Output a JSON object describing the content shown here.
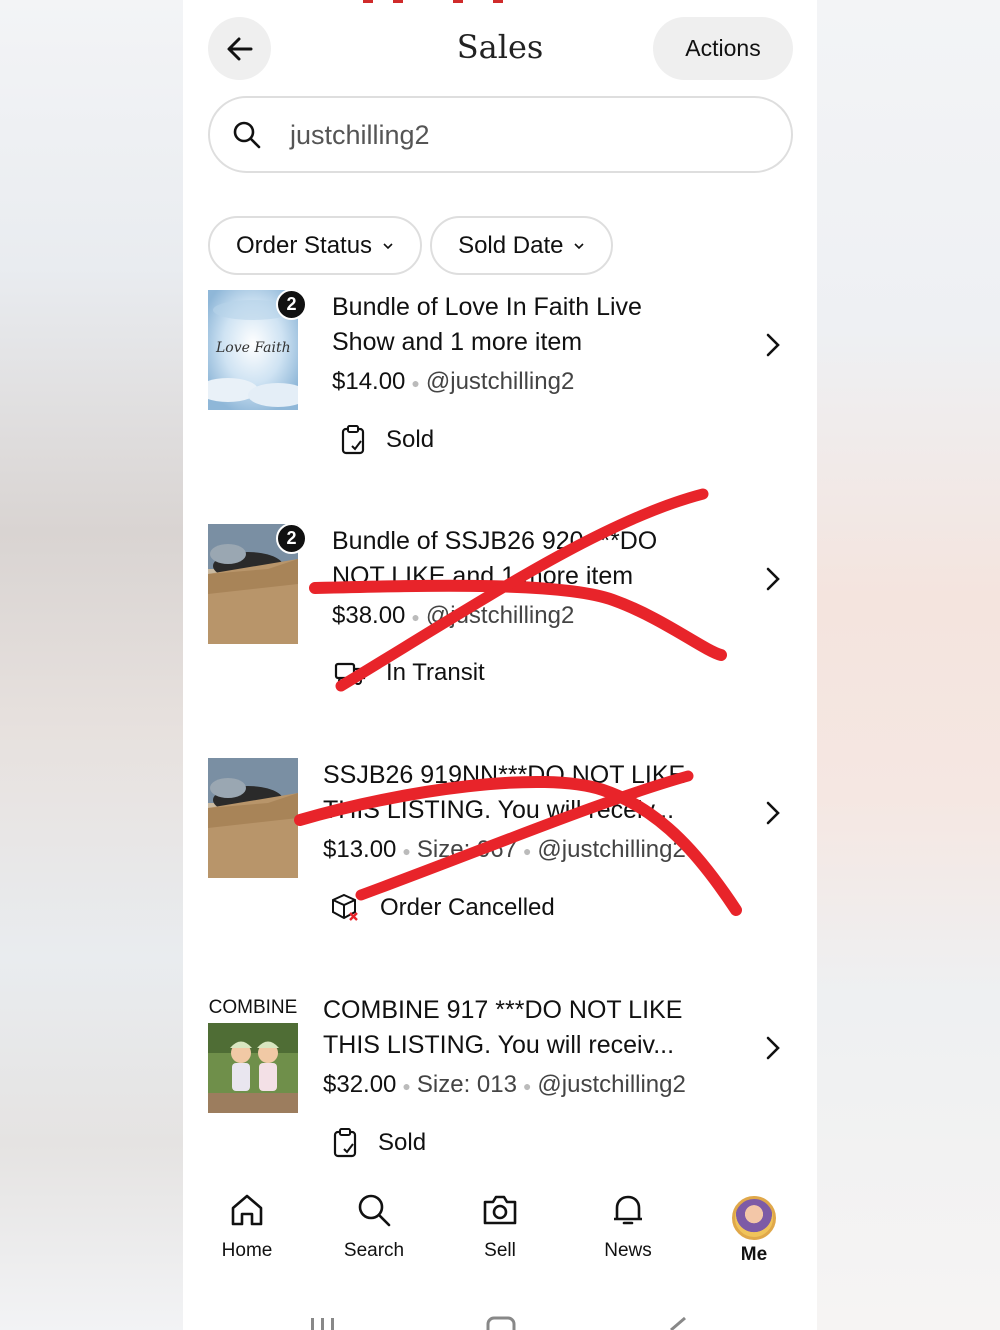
{
  "header": {
    "title": "Sales",
    "actions_label": "Actions"
  },
  "search": {
    "value": "justchilling2"
  },
  "filters": [
    {
      "label": "Order Status"
    },
    {
      "label": "Sold Date"
    }
  ],
  "orders": [
    {
      "title_line1": "Bundle of Love In Faith Live",
      "title_line2": "Show and 1 more item",
      "price": "$14.00",
      "size": "",
      "user": "@justchilling2",
      "status": "Sold",
      "badge": "2",
      "thumb_text": "Love Faith"
    },
    {
      "title_line1": "Bundle of SSJB26 920 ***DO",
      "title_line2": "NOT LIKE and 1 more item",
      "price": "$38.00",
      "size": "",
      "user": "@justchilling2",
      "status": "In Transit",
      "badge": "2"
    },
    {
      "title_line1": "SSJB26 919NN***DO NOT LIKE",
      "title_line2": "THIS LISTING. You will receiv...",
      "price": "$13.00",
      "size": "Size: 067",
      "user": "@justchilling2",
      "status": "Order Cancelled"
    },
    {
      "title_line1": "COMBINE 917 ***DO NOT LIKE",
      "title_line2": "THIS LISTING. You will receiv...",
      "price": "$32.00",
      "size": "Size: 013",
      "user": "@justchilling2",
      "status": "Sold",
      "thumb_text": "COMBINE"
    }
  ],
  "nav": [
    {
      "label": "Home",
      "icon": "home-icon"
    },
    {
      "label": "Search",
      "icon": "search-icon"
    },
    {
      "label": "Sell",
      "icon": "camera-icon"
    },
    {
      "label": "News",
      "icon": "bell-icon"
    },
    {
      "label": "Me",
      "icon": "avatar"
    }
  ],
  "colors": {
    "strike": "#e8242a",
    "chip_bg": "#efefef",
    "border": "#dedede"
  }
}
